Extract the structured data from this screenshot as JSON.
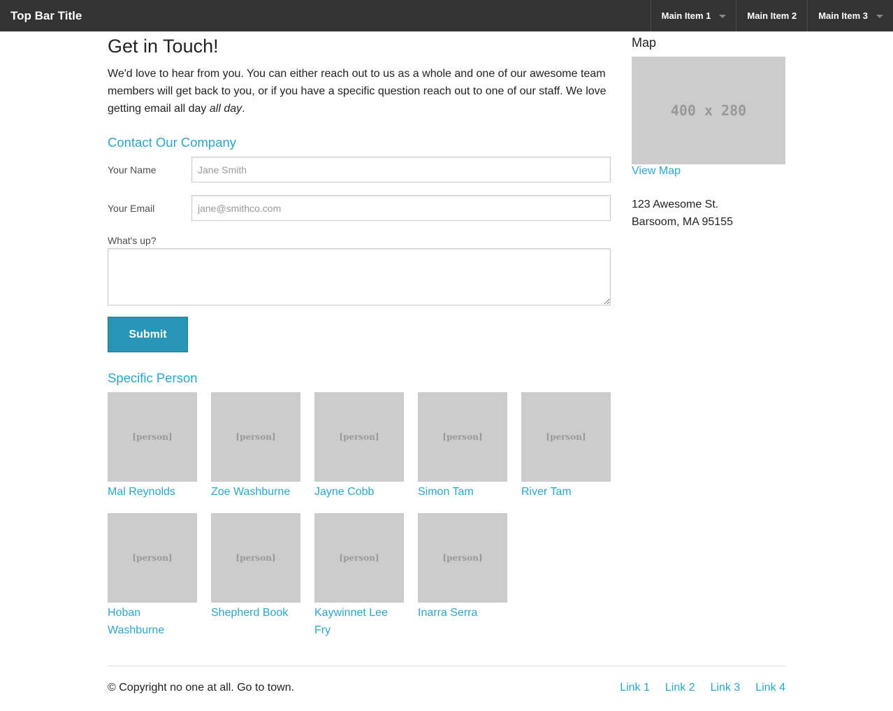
{
  "topbar": {
    "title": "Top Bar Title",
    "menu": [
      {
        "label": "Main Item 1",
        "has_dropdown": true
      },
      {
        "label": "Main Item 2",
        "has_dropdown": false
      },
      {
        "label": "Main Item 3",
        "has_dropdown": true
      }
    ]
  },
  "main": {
    "title": "Get in Touch!",
    "intro_text": "We'd love to hear from you. You can either reach out to us as a whole and one of our awesome team members will get back to you, or if you have a specific question reach out to one of our staff. We love getting email all day ",
    "intro_emphasis": "all day",
    "intro_end": ".",
    "contact_heading": "Contact Our Company",
    "form": {
      "name_label": "Your Name",
      "name_placeholder": "Jane Smith",
      "name_value": "",
      "email_label": "Your Email",
      "email_placeholder": "jane@smithco.com",
      "email_value": "",
      "message_label": "What's up?",
      "message_value": "",
      "submit_label": "Submit"
    },
    "people_heading": "Specific Person",
    "placeholder_text": "[person]",
    "people": [
      "Mal Reynolds",
      "Zoe Washburne",
      "Jayne Cobb",
      "Simon Tam",
      "River Tam",
      "Hoban Washburne",
      "Shepherd Book",
      "Kaywinnet Lee Fry",
      "Inarra Serra"
    ]
  },
  "sidebar": {
    "map_heading": "Map",
    "map_placeholder": "400 x 280",
    "view_map_label": "View Map",
    "address_line1": "123 Awesome St.",
    "address_line2": "Barsoom, MA 95155"
  },
  "footer": {
    "copyright": "© Copyright no one at all. Go to town.",
    "links": [
      "Link 1",
      "Link 2",
      "Link 3",
      "Link 4"
    ]
  },
  "colors": {
    "topbar_bg": "#333333",
    "link": "#2ba6cb",
    "button": "#2795b6",
    "placeholder_bg": "#cccccc"
  }
}
